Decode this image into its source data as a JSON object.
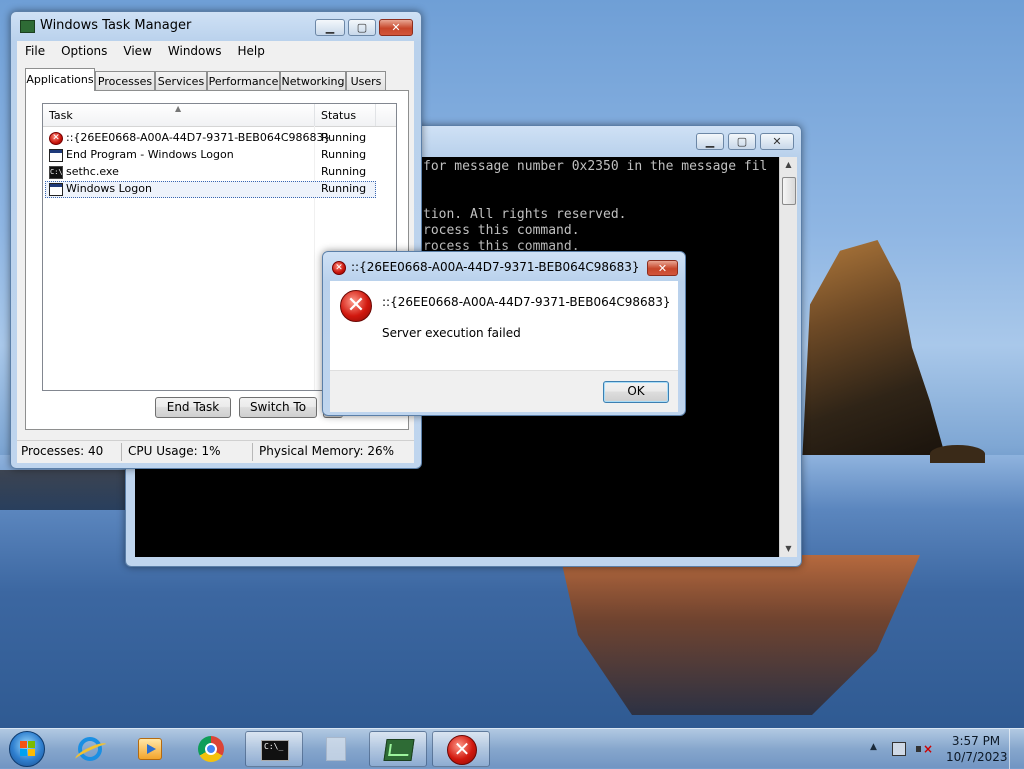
{
  "console": {
    "lines": [
      "for message number 0x2350 in the message fil",
      "tion.  All rights reserved.",
      "rocess this command.",
      "rocess this command."
    ]
  },
  "taskmgr": {
    "title": "Windows Task Manager",
    "menu": [
      "File",
      "Options",
      "View",
      "Windows",
      "Help"
    ],
    "tabs": [
      "Applications",
      "Processes",
      "Services",
      "Performance",
      "Networking",
      "Users"
    ],
    "active_tab": "Applications",
    "columns": {
      "task": "Task",
      "status": "Status"
    },
    "rows": [
      {
        "task": "::{26EE0668-A00A-44D7-9371-BEB064C98683}",
        "status": "Running",
        "icon": "error-icon"
      },
      {
        "task": "End Program - Windows Logon",
        "status": "Running",
        "icon": "program-window-icon"
      },
      {
        "task": "sethc.exe",
        "status": "Running",
        "icon": "console-icon"
      },
      {
        "task": "Windows Logon",
        "status": "Running",
        "icon": "program-window-icon",
        "selected": true
      }
    ],
    "buttons": {
      "end_task": "End Task",
      "switch_to": "Switch To"
    },
    "status": {
      "processes": "Processes: 40",
      "cpu": "CPU Usage: 1%",
      "memory": "Physical Memory: 26%"
    }
  },
  "dialog": {
    "title": "::{26EE0668-A00A-44D7-9371-BEB064C98683}",
    "heading": "::{26EE0668-A00A-44D7-9371-BEB064C98683}",
    "message": "Server execution failed",
    "ok": "OK"
  },
  "taskbar": {
    "items": [
      "internet-explorer-icon",
      "media-player-icon",
      "chrome-icon",
      "command-prompt-icon",
      "blank-program-icon",
      "task-manager-icon",
      "error-icon"
    ],
    "time": "3:57 PM",
    "date": "10/7/2023"
  },
  "colors": {
    "error_red": "#d1180e",
    "selection_border": "#3a66b0",
    "console_bg": "#000000",
    "console_text": "#c0c0c0"
  }
}
